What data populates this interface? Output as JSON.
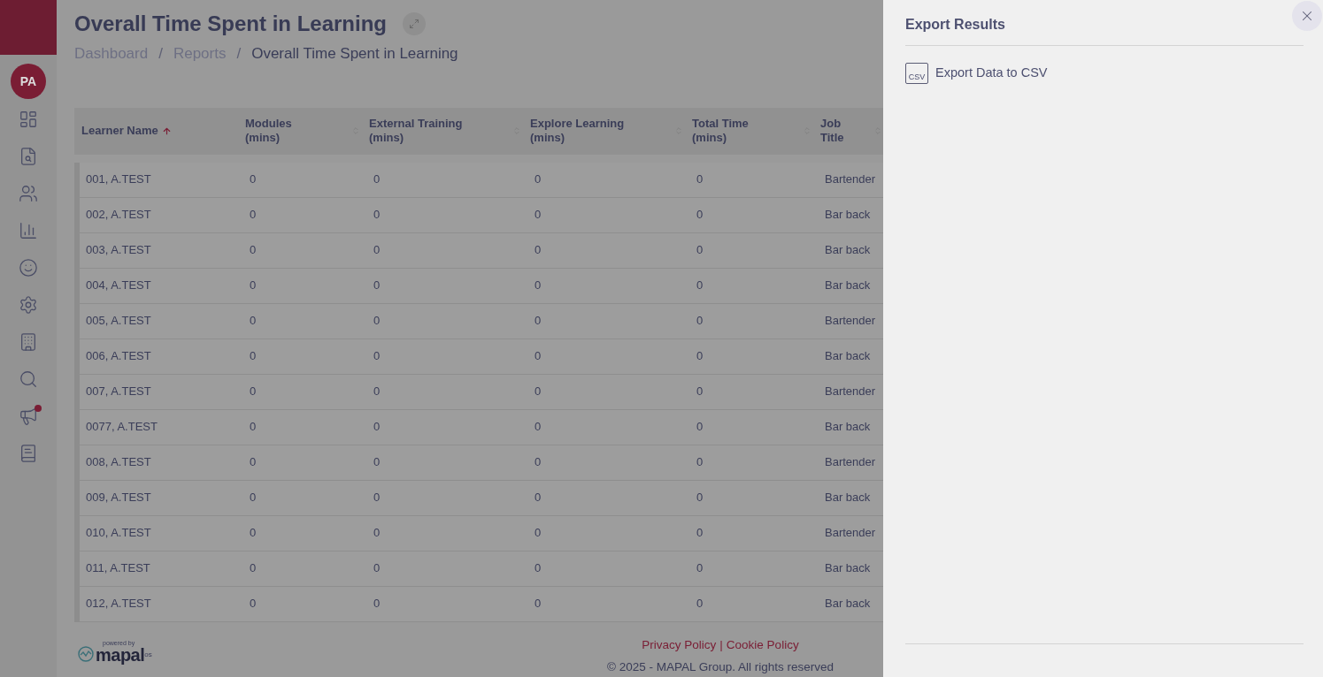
{
  "sidebar": {
    "avatar": "PA",
    "items": [
      {
        "kind": "dashboard",
        "badge": false
      },
      {
        "kind": "report-search",
        "badge": false
      },
      {
        "kind": "people",
        "badge": false
      },
      {
        "kind": "chart",
        "badge": false
      },
      {
        "kind": "smiley",
        "badge": false
      },
      {
        "kind": "settings",
        "badge": false
      },
      {
        "kind": "building",
        "badge": false
      },
      {
        "kind": "search",
        "badge": false
      },
      {
        "kind": "megaphone",
        "badge": true
      },
      {
        "kind": "info",
        "badge": false
      }
    ]
  },
  "page": {
    "title": "Overall Time Spent in Learning",
    "breadcrumb": [
      {
        "label": "Dashboard",
        "current": false
      },
      {
        "label": "Reports",
        "current": false
      },
      {
        "label": "Overall Time Spent in Learning",
        "current": true
      }
    ],
    "separator": "/"
  },
  "table": {
    "columns": [
      {
        "label": "Learner Name",
        "sorted": true
      },
      {
        "label": "Modules (mins)",
        "sorted": false
      },
      {
        "label": "External Training (mins)",
        "sorted": false
      },
      {
        "label": "Explore Learning (mins)",
        "sorted": false
      },
      {
        "label": "Total Time (mins)",
        "sorted": false
      },
      {
        "label": "Job Title",
        "sorted": false
      }
    ],
    "rows": [
      [
        "001, A.TEST",
        "0",
        "0",
        "0",
        "0",
        "Bartender"
      ],
      [
        "002, A.TEST",
        "0",
        "0",
        "0",
        "0",
        "Bar back"
      ],
      [
        "003, A.TEST",
        "0",
        "0",
        "0",
        "0",
        "Bar back"
      ],
      [
        "004, A.TEST",
        "0",
        "0",
        "0",
        "0",
        "Bar back"
      ],
      [
        "005, A.TEST",
        "0",
        "0",
        "0",
        "0",
        "Bartender"
      ],
      [
        "006, A.TEST",
        "0",
        "0",
        "0",
        "0",
        "Bar back"
      ],
      [
        "007, A.TEST",
        "0",
        "0",
        "0",
        "0",
        "Bartender"
      ],
      [
        "0077, A.TEST",
        "0",
        "0",
        "0",
        "0",
        "Bar back"
      ],
      [
        "008, A.TEST",
        "0",
        "0",
        "0",
        "0",
        "Bartender"
      ],
      [
        "009, A.TEST",
        "0",
        "0",
        "0",
        "0",
        "Bar back"
      ],
      [
        "010, A.TEST",
        "0",
        "0",
        "0",
        "0",
        "Bartender"
      ],
      [
        "011, A.TEST",
        "0",
        "0",
        "0",
        "0",
        "Bar back"
      ],
      [
        "012, A.TEST",
        "0",
        "0",
        "0",
        "0",
        "Bar back"
      ]
    ]
  },
  "footer": {
    "logo": {
      "tagline": "powered by",
      "name": "mapal",
      "suffix": "os"
    },
    "links": [
      "Privacy Policy",
      "Cookie Policy"
    ],
    "link_separator": "|",
    "copyright": "© 2025 - MAPAL Group. All rights reserved"
  },
  "export_panel": {
    "title": "Export Results",
    "items": [
      {
        "label": "Export Data to CSV",
        "icon_text": "CSV"
      }
    ]
  }
}
